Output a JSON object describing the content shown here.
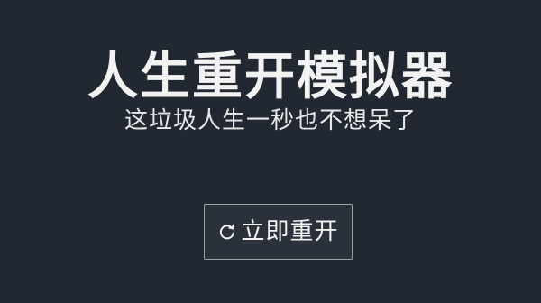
{
  "app": {
    "title": "人生重开模拟器",
    "subtitle": "这垃圾人生一秒也不想呆了"
  },
  "actions": {
    "restart_label": "立即重开",
    "restart_icon": "refresh-icon"
  },
  "colors": {
    "background": "#222831",
    "text": "#f2f2f2",
    "button_border": "#9aa0a8"
  }
}
